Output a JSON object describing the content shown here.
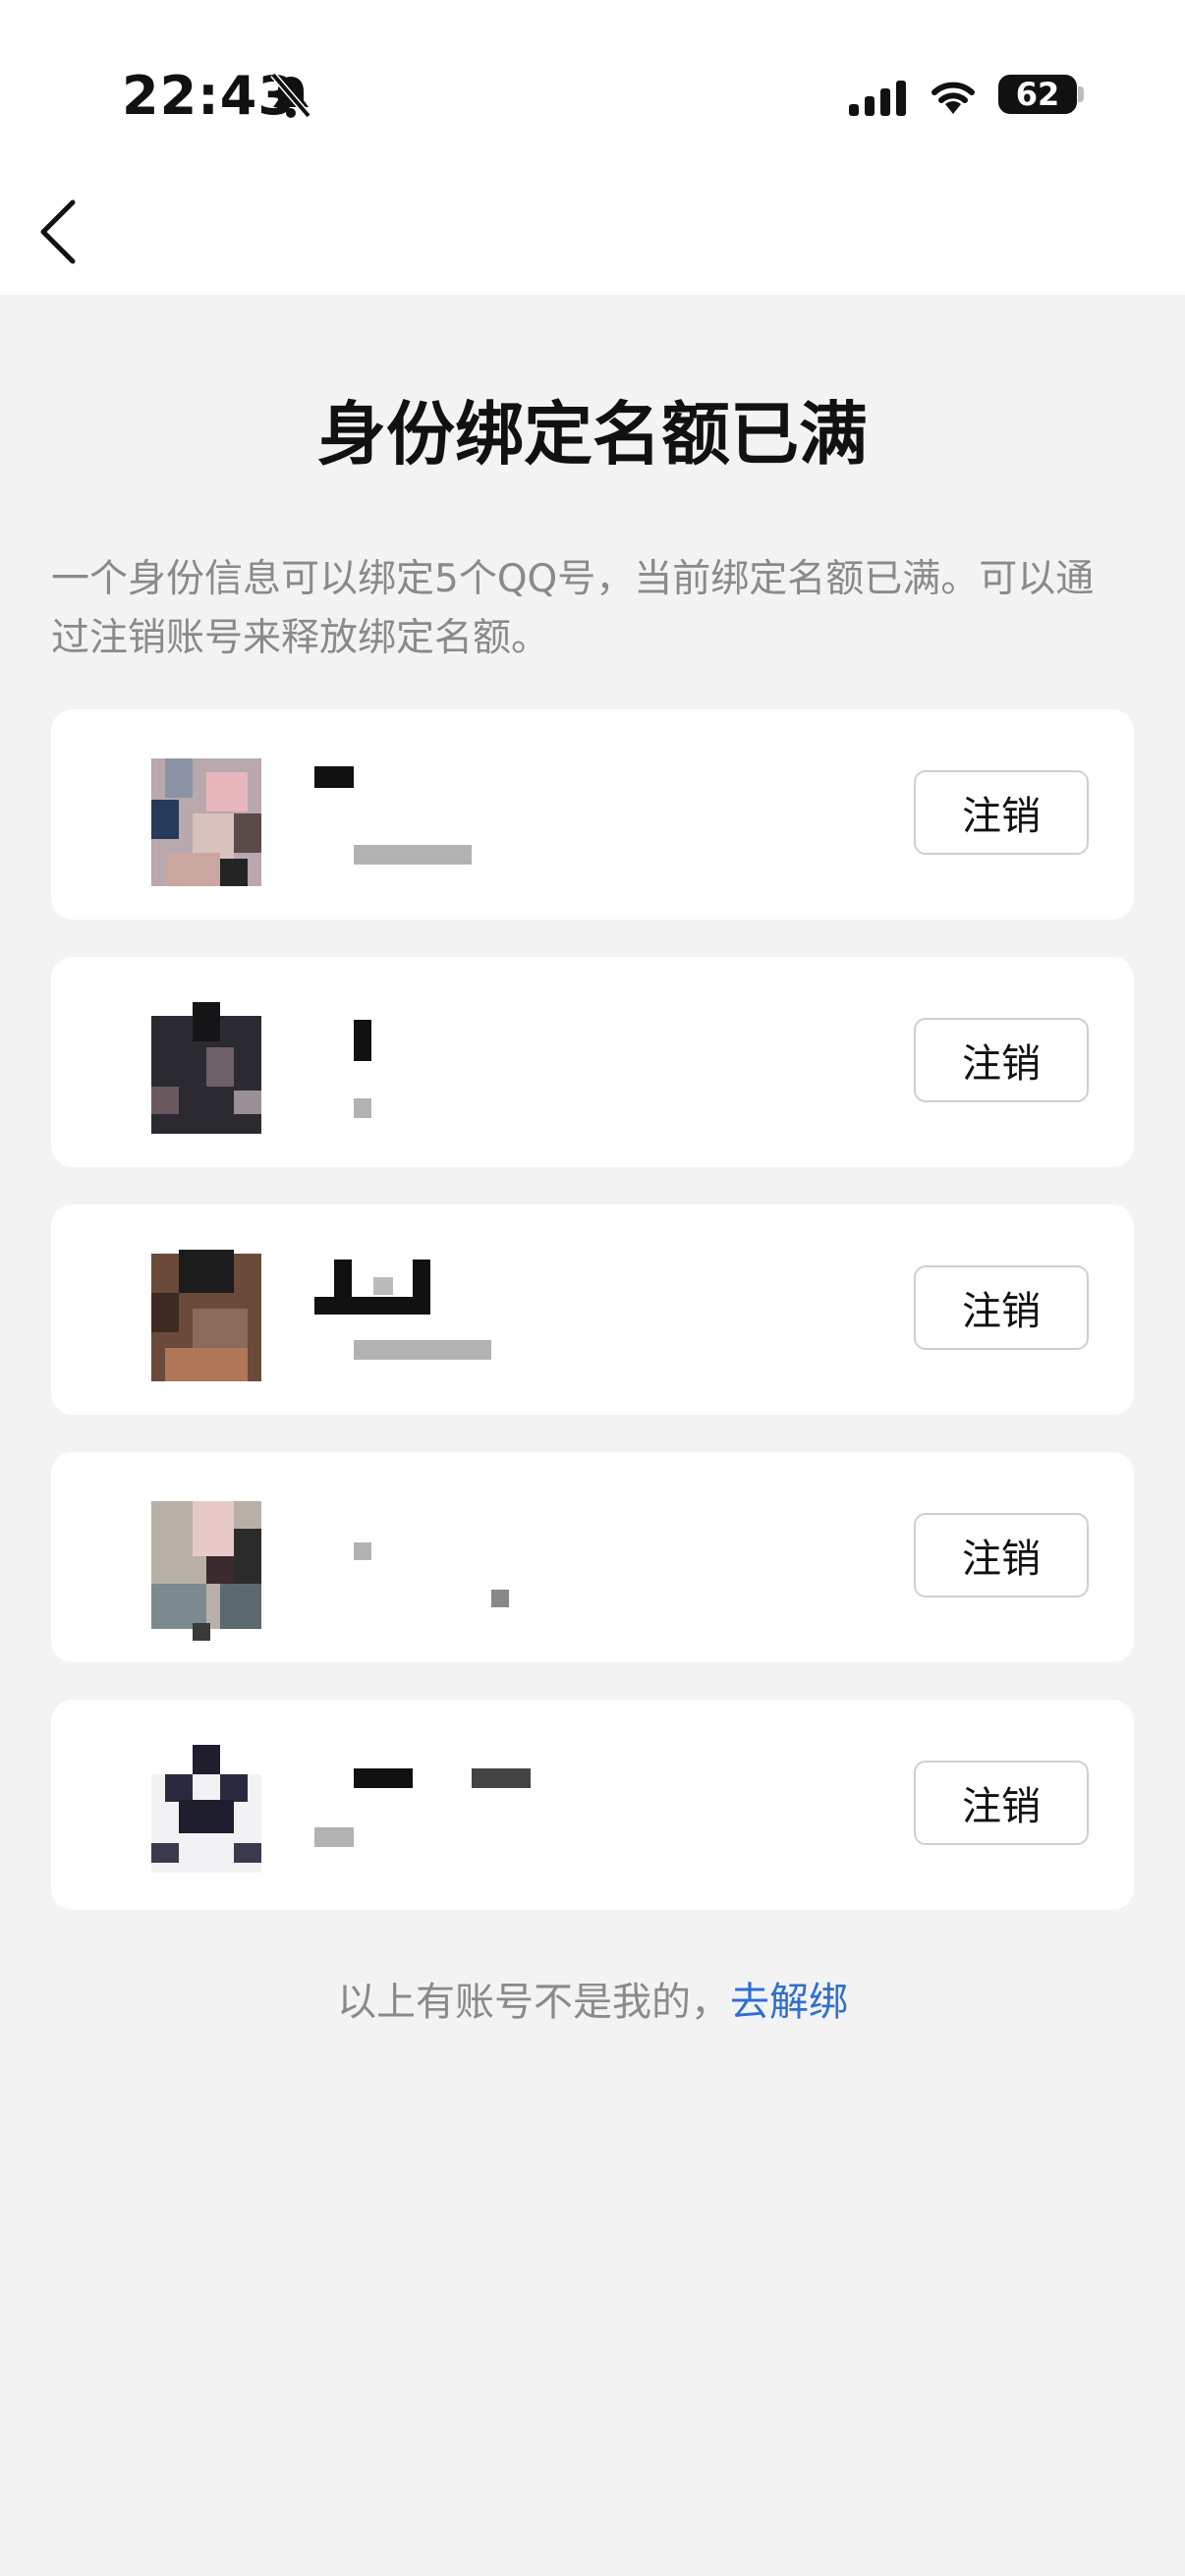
{
  "status_bar": {
    "time": "22:43",
    "battery": "62"
  },
  "page": {
    "title": "身份绑定名额已满",
    "description": "一个身份信息可以绑定5个QQ号，当前绑定名额已满。可以通过注销账号来释放绑定名额。"
  },
  "accounts": [
    {
      "action_label": "注销"
    },
    {
      "action_label": "注销"
    },
    {
      "action_label": "注销"
    },
    {
      "action_label": "注销"
    },
    {
      "action_label": "注销"
    }
  ],
  "footer": {
    "text": "以上有账号不是我的，",
    "link_label": "去解绑"
  },
  "colors": {
    "background": "#f3f3f3",
    "card": "#ffffff",
    "link": "#2f6fd0",
    "muted_text": "#8a8a8a"
  },
  "icons": [
    "bell-muted-icon",
    "signal-icon",
    "wifi-icon",
    "battery-icon",
    "back-chevron-icon"
  ]
}
